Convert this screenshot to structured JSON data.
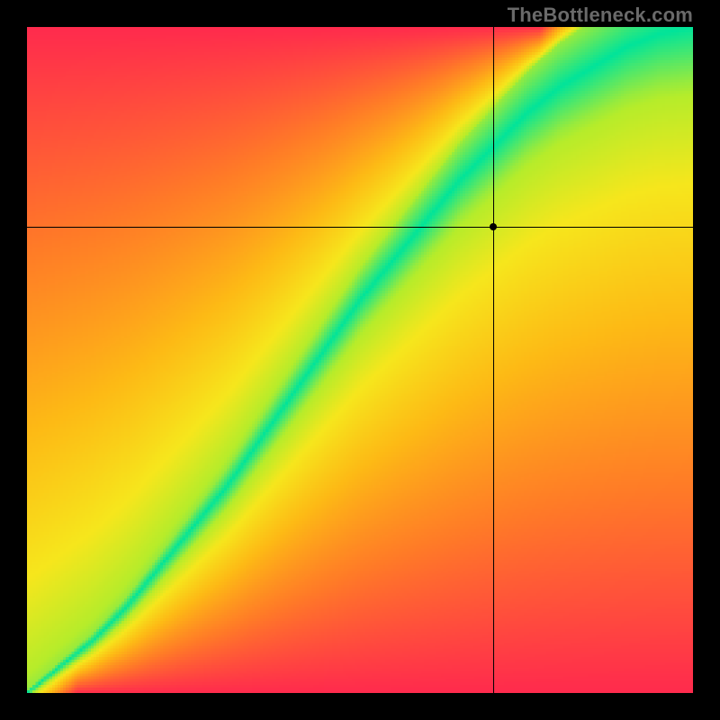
{
  "watermark": "TheBottleneck.com",
  "chart_data": {
    "type": "heatmap",
    "title": "",
    "xlabel": "",
    "ylabel": "",
    "xlim": [
      0,
      1
    ],
    "ylim": [
      0,
      1
    ],
    "crosshair": {
      "x": 0.7,
      "y": 0.7
    },
    "point": {
      "x": 0.7,
      "y": 0.7
    },
    "ridge": {
      "description": "Green ridge y as a function of x (values in normalized 0..1 space, bottom-left origin). Color encodes distance from this ridge: near=green, mid=yellow, near-corners towards top-left and bottom-right=red/orange.",
      "points": [
        {
          "x": 0.0,
          "y": 0.0
        },
        {
          "x": 0.05,
          "y": 0.04
        },
        {
          "x": 0.1,
          "y": 0.08
        },
        {
          "x": 0.15,
          "y": 0.13
        },
        {
          "x": 0.2,
          "y": 0.19
        },
        {
          "x": 0.25,
          "y": 0.25
        },
        {
          "x": 0.3,
          "y": 0.31
        },
        {
          "x": 0.35,
          "y": 0.38
        },
        {
          "x": 0.4,
          "y": 0.45
        },
        {
          "x": 0.45,
          "y": 0.52
        },
        {
          "x": 0.5,
          "y": 0.59
        },
        {
          "x": 0.55,
          "y": 0.65
        },
        {
          "x": 0.6,
          "y": 0.71
        },
        {
          "x": 0.65,
          "y": 0.77
        },
        {
          "x": 0.7,
          "y": 0.82
        },
        {
          "x": 0.75,
          "y": 0.87
        },
        {
          "x": 0.8,
          "y": 0.91
        },
        {
          "x": 0.85,
          "y": 0.94
        },
        {
          "x": 0.9,
          "y": 0.97
        },
        {
          "x": 0.95,
          "y": 0.99
        },
        {
          "x": 1.0,
          "y": 1.0
        }
      ],
      "half_width": {
        "description": "Approximate half-width of the green band (in y units) as a function of x.",
        "points": [
          {
            "x": 0.0,
            "w": 0.005
          },
          {
            "x": 0.1,
            "w": 0.012
          },
          {
            "x": 0.2,
            "w": 0.02
          },
          {
            "x": 0.3,
            "w": 0.028
          },
          {
            "x": 0.4,
            "w": 0.035
          },
          {
            "x": 0.5,
            "w": 0.042
          },
          {
            "x": 0.6,
            "w": 0.05
          },
          {
            "x": 0.7,
            "w": 0.058
          },
          {
            "x": 0.8,
            "w": 0.066
          },
          {
            "x": 0.9,
            "w": 0.074
          },
          {
            "x": 1.0,
            "w": 0.082
          }
        ]
      }
    },
    "color_stops": [
      {
        "t": 0.0,
        "color": "#00e49a"
      },
      {
        "t": 0.12,
        "color": "#b6ec2a"
      },
      {
        "t": 0.25,
        "color": "#f6e61c"
      },
      {
        "t": 0.45,
        "color": "#fdb915"
      },
      {
        "t": 0.7,
        "color": "#ff7a27"
      },
      {
        "t": 1.0,
        "color": "#ff2a4d"
      }
    ]
  }
}
